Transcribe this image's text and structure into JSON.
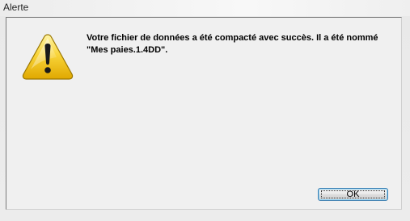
{
  "window": {
    "title": "Alerte"
  },
  "dialog": {
    "icon": "warning-icon",
    "message_line1": "Votre fichier de données a été compacté avec succès. Il a été nommé",
    "message_line2": "\"Mes paies.1.4DD\".",
    "ok_label": "OK"
  },
  "colors": {
    "warning_yellow": "#f3c300",
    "warning_border": "#8a6d00",
    "button_focus_border": "#3c7fb1"
  }
}
